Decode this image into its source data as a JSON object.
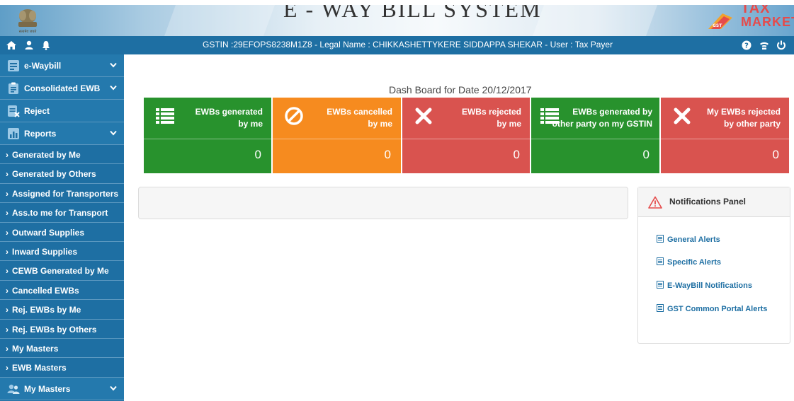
{
  "header": {
    "system_title": "E - WAY BILL SYSTEM",
    "logo": {
      "line1": "TAX",
      "line2": "MARKET",
      "badge": "GST"
    },
    "emblem_caption": "सत्यमेव जयते"
  },
  "topnav": {
    "icons": [
      "home-icon",
      "user-icon",
      "bell-icon",
      "help-icon",
      "network-icon",
      "power-icon"
    ],
    "gstin_text": "GSTIN :29EFOPS8238M1Z8 - Legal Name : CHIKKASHETTYKERE SIDDAPPA SHEKAR - User : Tax Payer"
  },
  "sidebar": {
    "ewaybill": "e-Waybill",
    "consolidated": "Consolidated EWB",
    "reject": "Reject",
    "reports": "Reports",
    "report_items": [
      "Generated by Me",
      "Generated by Others",
      "Assigned for Transporters",
      "Ass.to me for Transport",
      "Outward Supplies",
      "Inward Supplies",
      "CEWB Generated by Me",
      "Cancelled EWBs",
      "Rej. EWBs by Me",
      "Rej. EWBs by Others",
      "My Masters",
      "EWB Masters"
    ],
    "my_masters": "My Masters",
    "arrow": "›"
  },
  "dashboard": {
    "title": "Dash Board for Date 20/12/2017",
    "cards": [
      {
        "line1": "EWBs generated",
        "line2": "by me",
        "count": "0",
        "color": "#28922d",
        "icon": "list-icon"
      },
      {
        "line1": "EWBs cancelled",
        "line2": "by me",
        "count": "0",
        "color": "#f68b1f",
        "icon": "ban-icon"
      },
      {
        "line1": "EWBs rejected",
        "line2": "by me",
        "count": "0",
        "color": "#d9534f",
        "icon": "cross-icon"
      },
      {
        "line1": "EWBs generated by",
        "line2": "other party on my GSTIN",
        "count": "0",
        "color": "#28922d",
        "icon": "list-icon"
      },
      {
        "line1": "My EWBs rejected",
        "line2": "by other party",
        "count": "0",
        "color": "#d9534f",
        "icon": "cross-icon"
      }
    ]
  },
  "notifications": {
    "title": "Notifications Panel",
    "alerts": [
      "General Alerts",
      "Specific Alerts",
      "E-WayBill Notifications",
      "GST Common Portal Alerts"
    ]
  },
  "colors": {
    "nav_blue": "#1e6fa3",
    "green": "#28922d",
    "orange": "#f68b1f",
    "red": "#d9534f",
    "accent_red": "#e54b4b"
  }
}
